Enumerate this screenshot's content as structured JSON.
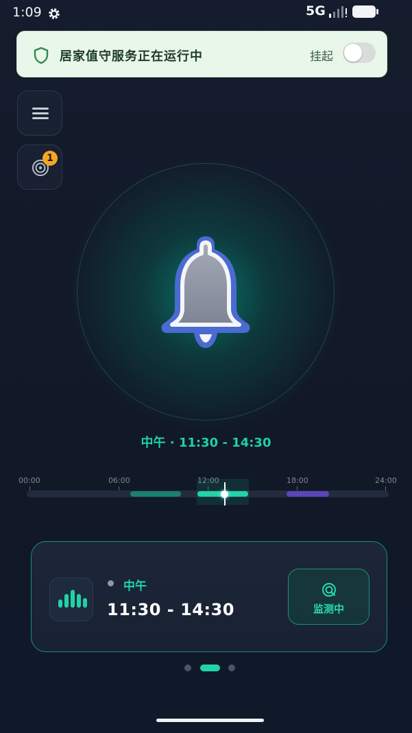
{
  "status_bar": {
    "time": "1:09",
    "network": "5G",
    "icons": [
      "gear-icon",
      "signal-icon",
      "battery-icon"
    ]
  },
  "banner": {
    "message": "居家值守服务正在运行中",
    "suspend_label": "挂起",
    "toggle_on": false,
    "icon": "shield-icon"
  },
  "side_buttons": {
    "menu_icon": "menu-icon",
    "radar_icon": "radar-icon",
    "radar_badge": "1"
  },
  "main": {
    "bell_icon": "bell-icon",
    "period_label": "中午 · 11:30 - 14:30"
  },
  "timeline": {
    "labels": [
      "00:00",
      "06:00",
      "12:00",
      "18:00",
      "24:00"
    ]
  },
  "card": {
    "icon": "audio-bars-icon",
    "period": "中午",
    "time_range": "11:30 - 14:30",
    "monitor_label": "监测中",
    "monitor_icon": "target-icon"
  },
  "pager": {
    "pages": 3,
    "active_index": 1
  },
  "colors": {
    "accent": "#21d4a8",
    "background": "#12192a",
    "banner_bg": "#e9f6ea",
    "evening_segment": "#5a46b8",
    "badge": "#f5a623"
  }
}
